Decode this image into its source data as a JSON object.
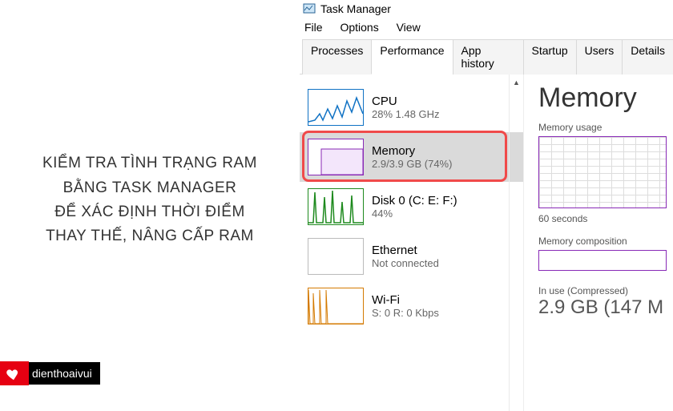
{
  "instruction": {
    "line1": "KIỂM TRA TÌNH TRẠNG RAM",
    "line2": "BẰNG TASK MANAGER",
    "line3": "ĐỂ XÁC ĐỊNH THỜI ĐIỂM",
    "line4": "THAY THẾ, NÂNG CẤP RAM"
  },
  "watermark": {
    "text": "dienthoaivui"
  },
  "window": {
    "title": "Task Manager"
  },
  "menu": {
    "file": "File",
    "options": "Options",
    "view": "View"
  },
  "tabs": {
    "processes": "Processes",
    "performance": "Performance",
    "appHistory": "App history",
    "startup": "Startup",
    "users": "Users",
    "details": "Details"
  },
  "categories": {
    "cpu": {
      "title": "CPU",
      "sub": "28% 1.48 GHz"
    },
    "memory": {
      "title": "Memory",
      "sub": "2.9/3.9 GB (74%)"
    },
    "disk": {
      "title": "Disk 0 (C: E: F:)",
      "sub": "44%"
    },
    "eth": {
      "title": "Ethernet",
      "sub": "Not connected"
    },
    "wifi": {
      "title": "Wi-Fi",
      "sub": "S: 0 R: 0 Kbps"
    }
  },
  "detail": {
    "title": "Memory",
    "usageLabel": "Memory usage",
    "timescale": "60 seconds",
    "compLabel": "Memory composition",
    "inuseLabel": "In use (Compressed)",
    "inuseValue": "2.9 GB (147 M"
  }
}
